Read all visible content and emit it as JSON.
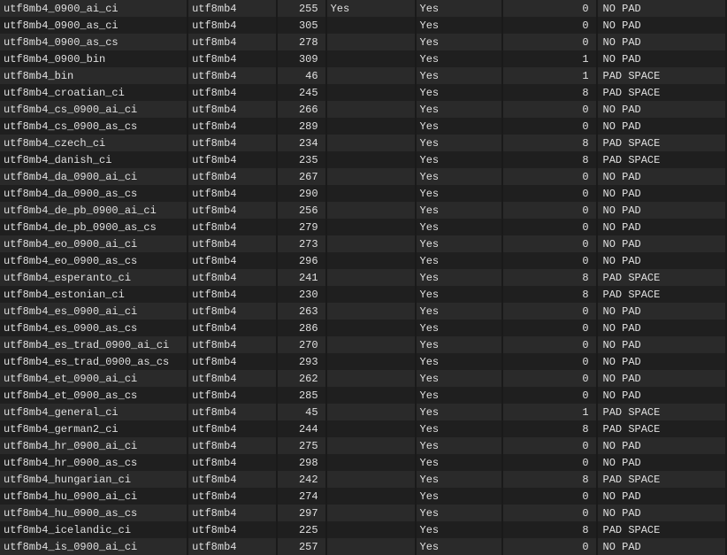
{
  "rows": [
    {
      "name": "utf8mb4_0900_ai_ci",
      "charset": "utf8mb4",
      "id": 255,
      "default": "Yes",
      "compiled": "Yes",
      "sortlen": 0,
      "pad": "NO PAD"
    },
    {
      "name": "utf8mb4_0900_as_ci",
      "charset": "utf8mb4",
      "id": 305,
      "default": "",
      "compiled": "Yes",
      "sortlen": 0,
      "pad": "NO PAD"
    },
    {
      "name": "utf8mb4_0900_as_cs",
      "charset": "utf8mb4",
      "id": 278,
      "default": "",
      "compiled": "Yes",
      "sortlen": 0,
      "pad": "NO PAD"
    },
    {
      "name": "utf8mb4_0900_bin",
      "charset": "utf8mb4",
      "id": 309,
      "default": "",
      "compiled": "Yes",
      "sortlen": 1,
      "pad": "NO PAD"
    },
    {
      "name": "utf8mb4_bin",
      "charset": "utf8mb4",
      "id": 46,
      "default": "",
      "compiled": "Yes",
      "sortlen": 1,
      "pad": "PAD SPACE"
    },
    {
      "name": "utf8mb4_croatian_ci",
      "charset": "utf8mb4",
      "id": 245,
      "default": "",
      "compiled": "Yes",
      "sortlen": 8,
      "pad": "PAD SPACE"
    },
    {
      "name": "utf8mb4_cs_0900_ai_ci",
      "charset": "utf8mb4",
      "id": 266,
      "default": "",
      "compiled": "Yes",
      "sortlen": 0,
      "pad": "NO PAD"
    },
    {
      "name": "utf8mb4_cs_0900_as_cs",
      "charset": "utf8mb4",
      "id": 289,
      "default": "",
      "compiled": "Yes",
      "sortlen": 0,
      "pad": "NO PAD"
    },
    {
      "name": "utf8mb4_czech_ci",
      "charset": "utf8mb4",
      "id": 234,
      "default": "",
      "compiled": "Yes",
      "sortlen": 8,
      "pad": "PAD SPACE"
    },
    {
      "name": "utf8mb4_danish_ci",
      "charset": "utf8mb4",
      "id": 235,
      "default": "",
      "compiled": "Yes",
      "sortlen": 8,
      "pad": "PAD SPACE"
    },
    {
      "name": "utf8mb4_da_0900_ai_ci",
      "charset": "utf8mb4",
      "id": 267,
      "default": "",
      "compiled": "Yes",
      "sortlen": 0,
      "pad": "NO PAD"
    },
    {
      "name": "utf8mb4_da_0900_as_cs",
      "charset": "utf8mb4",
      "id": 290,
      "default": "",
      "compiled": "Yes",
      "sortlen": 0,
      "pad": "NO PAD"
    },
    {
      "name": "utf8mb4_de_pb_0900_ai_ci",
      "charset": "utf8mb4",
      "id": 256,
      "default": "",
      "compiled": "Yes",
      "sortlen": 0,
      "pad": "NO PAD"
    },
    {
      "name": "utf8mb4_de_pb_0900_as_cs",
      "charset": "utf8mb4",
      "id": 279,
      "default": "",
      "compiled": "Yes",
      "sortlen": 0,
      "pad": "NO PAD"
    },
    {
      "name": "utf8mb4_eo_0900_ai_ci",
      "charset": "utf8mb4",
      "id": 273,
      "default": "",
      "compiled": "Yes",
      "sortlen": 0,
      "pad": "NO PAD"
    },
    {
      "name": "utf8mb4_eo_0900_as_cs",
      "charset": "utf8mb4",
      "id": 296,
      "default": "",
      "compiled": "Yes",
      "sortlen": 0,
      "pad": "NO PAD"
    },
    {
      "name": "utf8mb4_esperanto_ci",
      "charset": "utf8mb4",
      "id": 241,
      "default": "",
      "compiled": "Yes",
      "sortlen": 8,
      "pad": "PAD SPACE"
    },
    {
      "name": "utf8mb4_estonian_ci",
      "charset": "utf8mb4",
      "id": 230,
      "default": "",
      "compiled": "Yes",
      "sortlen": 8,
      "pad": "PAD SPACE"
    },
    {
      "name": "utf8mb4_es_0900_ai_ci",
      "charset": "utf8mb4",
      "id": 263,
      "default": "",
      "compiled": "Yes",
      "sortlen": 0,
      "pad": "NO PAD"
    },
    {
      "name": "utf8mb4_es_0900_as_cs",
      "charset": "utf8mb4",
      "id": 286,
      "default": "",
      "compiled": "Yes",
      "sortlen": 0,
      "pad": "NO PAD"
    },
    {
      "name": "utf8mb4_es_trad_0900_ai_ci",
      "charset": "utf8mb4",
      "id": 270,
      "default": "",
      "compiled": "Yes",
      "sortlen": 0,
      "pad": "NO PAD"
    },
    {
      "name": "utf8mb4_es_trad_0900_as_cs",
      "charset": "utf8mb4",
      "id": 293,
      "default": "",
      "compiled": "Yes",
      "sortlen": 0,
      "pad": "NO PAD"
    },
    {
      "name": "utf8mb4_et_0900_ai_ci",
      "charset": "utf8mb4",
      "id": 262,
      "default": "",
      "compiled": "Yes",
      "sortlen": 0,
      "pad": "NO PAD"
    },
    {
      "name": "utf8mb4_et_0900_as_cs",
      "charset": "utf8mb4",
      "id": 285,
      "default": "",
      "compiled": "Yes",
      "sortlen": 0,
      "pad": "NO PAD"
    },
    {
      "name": "utf8mb4_general_ci",
      "charset": "utf8mb4",
      "id": 45,
      "default": "",
      "compiled": "Yes",
      "sortlen": 1,
      "pad": "PAD SPACE"
    },
    {
      "name": "utf8mb4_german2_ci",
      "charset": "utf8mb4",
      "id": 244,
      "default": "",
      "compiled": "Yes",
      "sortlen": 8,
      "pad": "PAD SPACE"
    },
    {
      "name": "utf8mb4_hr_0900_ai_ci",
      "charset": "utf8mb4",
      "id": 275,
      "default": "",
      "compiled": "Yes",
      "sortlen": 0,
      "pad": "NO PAD"
    },
    {
      "name": "utf8mb4_hr_0900_as_cs",
      "charset": "utf8mb4",
      "id": 298,
      "default": "",
      "compiled": "Yes",
      "sortlen": 0,
      "pad": "NO PAD"
    },
    {
      "name": "utf8mb4_hungarian_ci",
      "charset": "utf8mb4",
      "id": 242,
      "default": "",
      "compiled": "Yes",
      "sortlen": 8,
      "pad": "PAD SPACE"
    },
    {
      "name": "utf8mb4_hu_0900_ai_ci",
      "charset": "utf8mb4",
      "id": 274,
      "default": "",
      "compiled": "Yes",
      "sortlen": 0,
      "pad": "NO PAD"
    },
    {
      "name": "utf8mb4_hu_0900_as_cs",
      "charset": "utf8mb4",
      "id": 297,
      "default": "",
      "compiled": "Yes",
      "sortlen": 0,
      "pad": "NO PAD"
    },
    {
      "name": "utf8mb4_icelandic_ci",
      "charset": "utf8mb4",
      "id": 225,
      "default": "",
      "compiled": "Yes",
      "sortlen": 8,
      "pad": "PAD SPACE"
    },
    {
      "name": "utf8mb4_is_0900_ai_ci",
      "charset": "utf8mb4",
      "id": 257,
      "default": "",
      "compiled": "Yes",
      "sortlen": 0,
      "pad": "NO PAD"
    }
  ]
}
